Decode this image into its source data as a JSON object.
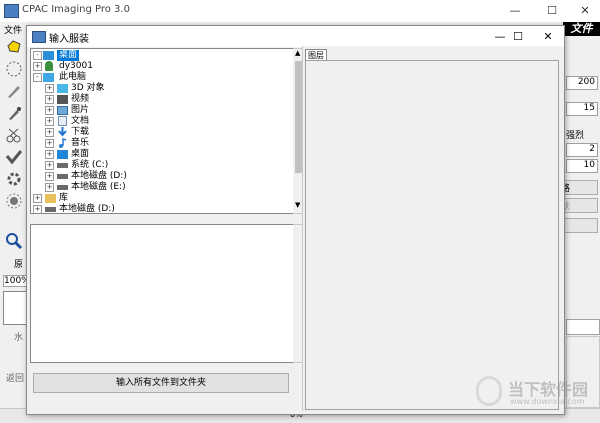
{
  "main_window": {
    "title": "CPAC Imaging Pro 3.0",
    "menu": [
      "文件"
    ],
    "minimize": "—",
    "maximize": "☐",
    "close": "✕",
    "banner_text": "文件",
    "left_labels": {
      "yuan": "原",
      "zoom": "100%",
      "water": "水",
      "back": "返回"
    },
    "right_values": [
      "200",
      "15",
      "2",
      "10"
    ],
    "right_labels": {
      "strong": "强烈",
      "lu": "路",
      "fu": "肤"
    },
    "progress_text": "0%"
  },
  "dialog": {
    "title": "输入服装",
    "minimize": "—",
    "maximize": "☐",
    "close": "✕",
    "tree": [
      {
        "label": "桌面",
        "level": 0,
        "expander": "-",
        "selected": true
      },
      {
        "label": "dy3001",
        "level": 1,
        "expander": "+"
      },
      {
        "label": "此电脑",
        "level": 1,
        "expander": "-"
      },
      {
        "label": "3D 对象",
        "level": 2,
        "expander": "+"
      },
      {
        "label": "视频",
        "level": 2,
        "expander": "+"
      },
      {
        "label": "图片",
        "level": 2,
        "expander": "+"
      },
      {
        "label": "文档",
        "level": 2,
        "expander": "+"
      },
      {
        "label": "下载",
        "level": 2,
        "expander": "+"
      },
      {
        "label": "音乐",
        "level": 2,
        "expander": "+"
      },
      {
        "label": "桌面",
        "level": 2,
        "expander": "+"
      },
      {
        "label": "系统 (C:)",
        "level": 2,
        "expander": "+"
      },
      {
        "label": "本地磁盘 (D:)",
        "level": 2,
        "expander": "+"
      },
      {
        "label": "本地磁盘 (E:)",
        "level": 2,
        "expander": "+"
      },
      {
        "label": "库",
        "level": 0,
        "expander": "+"
      },
      {
        "label": "本地磁盘 (D:)",
        "level": 0,
        "expander": "+"
      }
    ],
    "preview_tab": "图层",
    "import_button": "输入所有文件到文件夹"
  },
  "watermark": {
    "text": "当下软件园",
    "url": "www.downxia.com"
  }
}
